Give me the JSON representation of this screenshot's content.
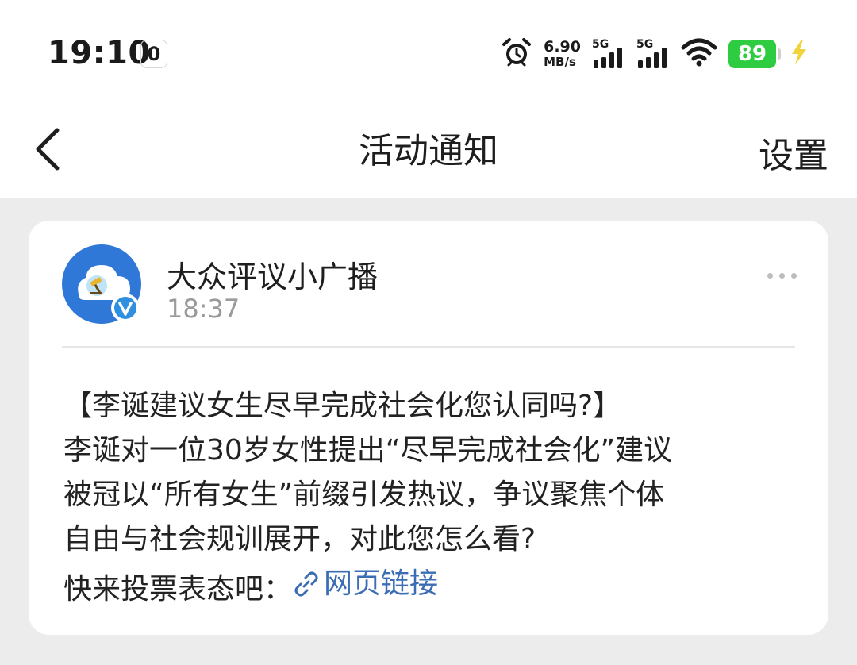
{
  "status_bar": {
    "time": "19:10",
    "notif_badge": "0",
    "speed_value": "6.90",
    "speed_unit": "MB/s",
    "sim1_tag": "5G",
    "sim2_tag": "5G",
    "battery_level": "89",
    "battery_color": "#2ecc40",
    "icons": [
      "alarm-icon",
      "signal-icon",
      "signal-icon",
      "wifi-icon",
      "battery-icon",
      "charging-icon"
    ]
  },
  "navbar": {
    "title": "活动通知",
    "settings_label": "设置",
    "back_icon": "chevron-left-icon"
  },
  "message": {
    "sender": "大众评议小广播",
    "time": "18:37",
    "lines": [
      "【李诞建议女生尽早完成社会化您认同吗?】",
      "李诞对一位30岁女性提出“尽早完成社会化”建议",
      "被冠以“所有女生”前缀引发热议，争议聚焦个体",
      "自由与社会规训展开，对此您怎么看?"
    ],
    "cta_prefix": "快来投票表态吧：",
    "link_label": "网页链接",
    "link_color": "#3b6db5"
  }
}
